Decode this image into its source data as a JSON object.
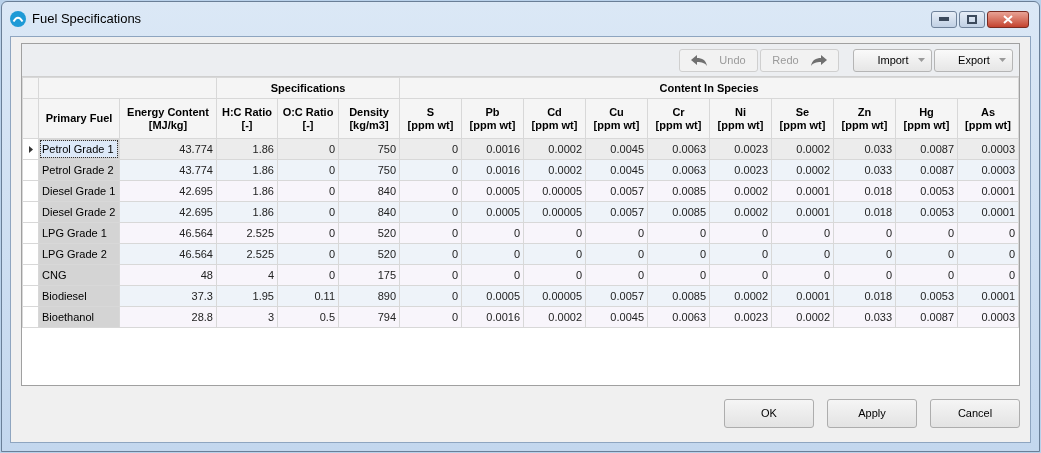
{
  "window": {
    "title": "Fuel Specifications"
  },
  "toolbar": {
    "undo": {
      "label": "Undo",
      "disabled": true
    },
    "redo": {
      "label": "Redo",
      "disabled": true
    },
    "menus": [
      {
        "label": "Import"
      },
      {
        "label": "Export"
      }
    ]
  },
  "table": {
    "column_groups": [
      {
        "columns": [
          {
            "name": "Primary Fuel"
          },
          {
            "name": "Energy Content",
            "unit": "[MJ/kg]"
          }
        ]
      },
      {
        "label": "Specifications",
        "columns": [
          {
            "name": "H:C Ratio",
            "unit": "[-]"
          },
          {
            "name": "O:C Ratio",
            "unit": "[-]"
          },
          {
            "name": "Density",
            "unit": "[kg/m3]"
          }
        ]
      },
      {
        "label": "Content In Species",
        "columns": [
          {
            "name": "S",
            "unit": "[ppm wt]"
          },
          {
            "name": "Pb",
            "unit": "[ppm wt]"
          },
          {
            "name": "Cd",
            "unit": "[ppm wt]"
          },
          {
            "name": "Cu",
            "unit": "[ppm wt]"
          },
          {
            "name": "Cr",
            "unit": "[ppm wt]"
          },
          {
            "name": "Ni",
            "unit": "[ppm wt]"
          },
          {
            "name": "Se",
            "unit": "[ppm wt]"
          },
          {
            "name": "Zn",
            "unit": "[ppm wt]"
          },
          {
            "name": "Hg",
            "unit": "[ppm wt]"
          },
          {
            "name": "As",
            "unit": "[ppm wt]"
          }
        ]
      }
    ],
    "rows": [
      {
        "selected": true,
        "cells": [
          "Petrol Grade 1",
          "43.774",
          "1.86",
          "0",
          "750",
          "0",
          "0.0016",
          "0.0002",
          "0.0045",
          "0.0063",
          "0.0023",
          "0.0002",
          "0.033",
          "0.0087",
          "0.0003"
        ]
      },
      {
        "selected": false,
        "cells": [
          "Petrol Grade 2",
          "43.774",
          "1.86",
          "0",
          "750",
          "0",
          "0.0016",
          "0.0002",
          "0.0045",
          "0.0063",
          "0.0023",
          "0.0002",
          "0.033",
          "0.0087",
          "0.0003"
        ]
      },
      {
        "selected": false,
        "cells": [
          "Diesel Grade 1",
          "42.695",
          "1.86",
          "0",
          "840",
          "0",
          "0.0005",
          "0.00005",
          "0.0057",
          "0.0085",
          "0.0002",
          "0.0001",
          "0.018",
          "0.0053",
          "0.0001"
        ]
      },
      {
        "selected": false,
        "cells": [
          "Diesel Grade 2",
          "42.695",
          "1.86",
          "0",
          "840",
          "0",
          "0.0005",
          "0.00005",
          "0.0057",
          "0.0085",
          "0.0002",
          "0.0001",
          "0.018",
          "0.0053",
          "0.0001"
        ]
      },
      {
        "selected": false,
        "cells": [
          "LPG Grade 1",
          "46.564",
          "2.525",
          "0",
          "520",
          "0",
          "0",
          "0",
          "0",
          "0",
          "0",
          "0",
          "0",
          "0",
          "0"
        ]
      },
      {
        "selected": false,
        "cells": [
          "LPG Grade 2",
          "46.564",
          "2.525",
          "0",
          "520",
          "0",
          "0",
          "0",
          "0",
          "0",
          "0",
          "0",
          "0",
          "0",
          "0"
        ]
      },
      {
        "selected": false,
        "cells": [
          "CNG",
          "48",
          "4",
          "0",
          "175",
          "0",
          "0",
          "0",
          "0",
          "0",
          "0",
          "0",
          "0",
          "0",
          "0"
        ]
      },
      {
        "selected": false,
        "cells": [
          "Biodiesel",
          "37.3",
          "1.95",
          "0.11",
          "890",
          "0",
          "0.0005",
          "0.00005",
          "0.0057",
          "0.0085",
          "0.0002",
          "0.0001",
          "0.018",
          "0.0053",
          "0.0001"
        ]
      },
      {
        "selected": false,
        "cells": [
          "Bioethanol",
          "28.8",
          "3",
          "0.5",
          "794",
          "0",
          "0.0016",
          "0.0002",
          "0.0045",
          "0.0063",
          "0.0023",
          "0.0002",
          "0.033",
          "0.0087",
          "0.0003"
        ]
      }
    ]
  },
  "buttons": [
    {
      "label": "OK"
    },
    {
      "label": "Apply"
    },
    {
      "label": "Cancel"
    }
  ]
}
